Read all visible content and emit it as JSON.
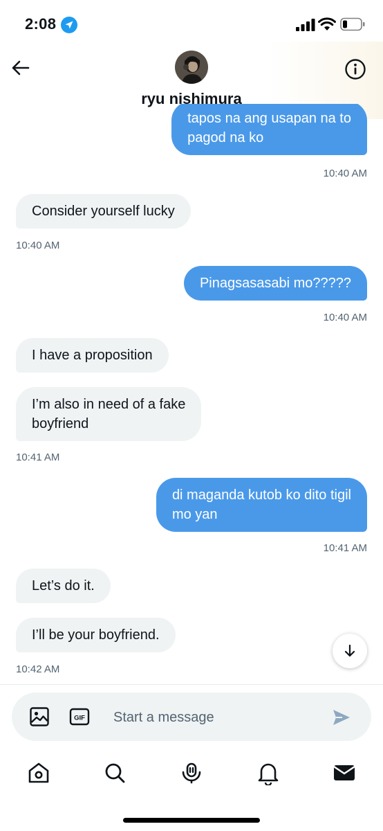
{
  "status_bar": {
    "time": "2:08"
  },
  "header": {
    "contact_name": "ryu nishimura"
  },
  "messages": [
    {
      "direction": "out",
      "lines": [
        "tapos na ang usapan na to",
        "pagod na ko"
      ]
    },
    {
      "direction": "in",
      "lines": [
        "Consider yourself lucky"
      ]
    },
    {
      "direction": "out",
      "lines": [
        "Pinagsasasabi mo?????"
      ]
    },
    {
      "direction": "in",
      "lines": [
        "I have a proposition"
      ]
    },
    {
      "direction": "in",
      "lines": [
        "I’m also in need of a fake",
        "boyfriend"
      ]
    },
    {
      "direction": "out",
      "lines": [
        "di maganda kutob ko dito tigil",
        "mo yan"
      ]
    },
    {
      "direction": "in",
      "lines": [
        "Let’s do it."
      ]
    },
    {
      "direction": "in",
      "lines": [
        "I’ll be your boyfriend."
      ]
    }
  ],
  "timestamps": [
    "10:40 AM",
    "10:40 AM",
    "10:40 AM",
    "10:41 AM",
    "10:41 AM",
    "10:42 AM"
  ],
  "composer": {
    "placeholder": "Start a message",
    "gif_label": "GIF"
  },
  "colors": {
    "outgoing_bubble": "#4a99e9",
    "incoming_bubble": "#eff3f4",
    "timestamp": "#536471",
    "accent": "#1d9bf0"
  },
  "icons": {
    "status": [
      "location-arrow-icon",
      "cellular-signal-icon",
      "wifi-icon",
      "battery-icon"
    ],
    "header": [
      "back-arrow-icon",
      "info-icon"
    ],
    "composer": [
      "image-icon",
      "gif-icon",
      "send-icon"
    ],
    "tabs": [
      "home-icon",
      "search-icon",
      "spaces-icon",
      "notifications-icon",
      "messages-icon"
    ],
    "scroll": "arrow-down-icon"
  }
}
